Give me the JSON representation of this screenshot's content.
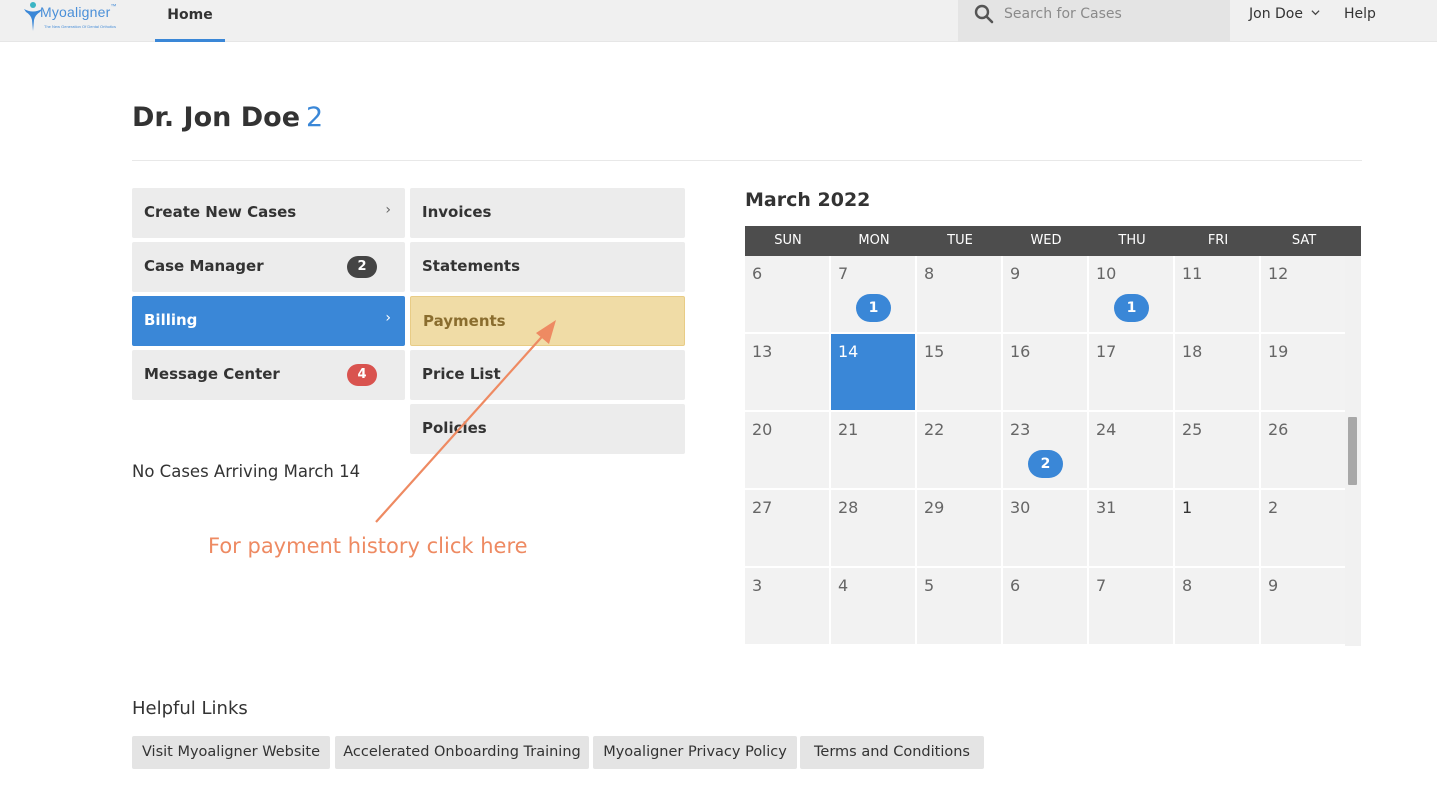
{
  "navbar": {
    "logo_text": "Myoaligner",
    "logo_tm": "™",
    "logo_tagline": "The New Generation Of Dental Orthotics",
    "home_label": "Home",
    "search_placeholder": "Search for Cases",
    "user_name": "Jon Doe",
    "help_label": "Help",
    "accent_color": "#3a87d7"
  },
  "header": {
    "title": "Dr. Jon Doe",
    "count": "2"
  },
  "menu": {
    "items": [
      {
        "label": "Create New Cases",
        "badge": "",
        "chevron": "›"
      },
      {
        "label": "Case Manager",
        "badge": "2"
      },
      {
        "label": "Billing",
        "chevron": "›",
        "active": true
      },
      {
        "label": "Message Center",
        "badge": "4"
      }
    ]
  },
  "submenu": {
    "items": [
      {
        "label": "Invoices"
      },
      {
        "label": "Statements"
      },
      {
        "label": "Payments",
        "highlighted": true
      },
      {
        "label": "Price List"
      },
      {
        "label": "Policies"
      }
    ]
  },
  "no_cases_text": "No Cases Arriving March 14",
  "annotation": {
    "text": "For payment history click here",
    "color": "#ee8a62"
  },
  "calendar": {
    "title": "March 2022",
    "days_of_week": [
      "SUN",
      "MON",
      "TUE",
      "WED",
      "THU",
      "FRI",
      "SAT"
    ],
    "weeks": [
      [
        {
          "d": "6"
        },
        {
          "d": "7",
          "count": "1"
        },
        {
          "d": "8"
        },
        {
          "d": "9"
        },
        {
          "d": "10",
          "count": "1"
        },
        {
          "d": "11"
        },
        {
          "d": "12"
        }
      ],
      [
        {
          "d": "13"
        },
        {
          "d": "14",
          "today": true
        },
        {
          "d": "15"
        },
        {
          "d": "16"
        },
        {
          "d": "17"
        },
        {
          "d": "18"
        },
        {
          "d": "19"
        }
      ],
      [
        {
          "d": "20"
        },
        {
          "d": "21"
        },
        {
          "d": "22"
        },
        {
          "d": "23",
          "count": "2"
        },
        {
          "d": "24"
        },
        {
          "d": "25"
        },
        {
          "d": "26"
        }
      ],
      [
        {
          "d": "27"
        },
        {
          "d": "28"
        },
        {
          "d": "29"
        },
        {
          "d": "30"
        },
        {
          "d": "31"
        },
        {
          "d": "1",
          "other": true
        },
        {
          "d": "2"
        }
      ],
      [
        {
          "d": "3"
        },
        {
          "d": "4"
        },
        {
          "d": "5"
        },
        {
          "d": "6"
        },
        {
          "d": "7"
        },
        {
          "d": "8"
        },
        {
          "d": "9"
        }
      ]
    ]
  },
  "helpful_links": {
    "title": "Helpful Links",
    "links": [
      "Visit Myoaligner Website",
      "Accelerated Onboarding Training",
      "Myoaligner Privacy Policy",
      "Terms and Conditions"
    ]
  }
}
